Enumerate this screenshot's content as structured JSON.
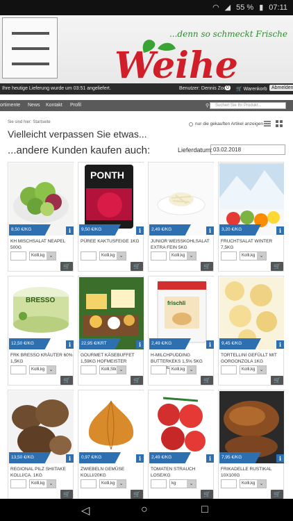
{
  "status_bar": {
    "battery": "55 %",
    "time": "07:11"
  },
  "header": {
    "slogan": "...denn so schmeckt Frische",
    "logo_text": "Weihe"
  },
  "topbar": {
    "delivery_note": "Ihre heutige Lieferung wurde um 03:51 angeliefert.",
    "user_label": "Benutzer: Dennis Zoch",
    "cart_count": "0",
    "cart_label": "Warenkorb",
    "logout_label": "Abmelden"
  },
  "navbar": {
    "items": [
      "ortimente",
      "News",
      "Kontakt",
      "Profil"
    ],
    "search_placeholder": "Suchen Sie Ihr Produkt..."
  },
  "breadcrumb": "Sie sind hier: Startseite",
  "headline1": "Vielleicht verpassen Sie etwas...",
  "headline2": "...andere Kunden kaufen auch:",
  "filter_label": "nur die gekauften Artikel anzeigen",
  "delivery_date_label": "Lieferdatum:",
  "delivery_date_value": "03.02.2018",
  "products": [
    {
      "price": "8,50 €/KG",
      "name": "KH MISCHSALAT NEAPEL 500G",
      "unit": "Kolli,kg",
      "icon": "salad"
    },
    {
      "price": "9,50 €/KG",
      "name": "PÜREE KAKTUSFEIGE 1KG",
      "unit": "Kolli,kg",
      "icon": "puree"
    },
    {
      "price": "2,49 €/KG",
      "name": "JUNIOR WEISSKOHLSALAT EXTRA FEIN 5KG",
      "unit": "Kolli,kg",
      "icon": "coleslaw"
    },
    {
      "price": "3,20 €/KG",
      "name": "FRUCHTSALAT WINTER 7,5KG",
      "unit": "Kolli,kg",
      "icon": "fruit"
    },
    {
      "price": "12,50 €/KG",
      "name": "FRK BRESSO KRÄUTER 60% 1,5KG",
      "unit": "Kolli,kg",
      "icon": "cheese-tub"
    },
    {
      "price": "22,95 €/KRT",
      "name": "GOURMET KÄSEBUFFET 1,59KG HOFMEISTER",
      "unit": "Kolli,Stk",
      "icon": "cheese-buffet"
    },
    {
      "price": "2,49 €/KG",
      "name": "H-MILCHPUDDING BUTTERKEKS 1,5% 5KG FRISCHLI",
      "unit": "Kolli,kg",
      "icon": "pudding-bucket"
    },
    {
      "price": "9,45 €/KG",
      "name": "TORTELLINI GEFÜLLT MIT GORGONZOLA 1KG",
      "unit": "Kolli,kg",
      "icon": "tortellini"
    },
    {
      "price": "13,50 €/KG",
      "name": "REGIONAL PILZ SHIITAKE KOLLI/CA. 1KG",
      "unit": "Kolli,kg",
      "icon": "mushroom"
    },
    {
      "price": "0,97 €/KG",
      "name": "ZWIEBELN GEMÜSE KOLLI/20KG",
      "unit": "Kolli,kg",
      "icon": "onion"
    },
    {
      "price": "2,49 €/KG",
      "name": "TOMATEN STRAUCH LOSE/KG",
      "unit": "kg",
      "icon": "tomato"
    },
    {
      "price": "7,95 €/KG",
      "name": "FRIKADELLE RUSTIKAL 10X100G",
      "unit": "Kolli,kg",
      "icon": "meatball"
    }
  ]
}
